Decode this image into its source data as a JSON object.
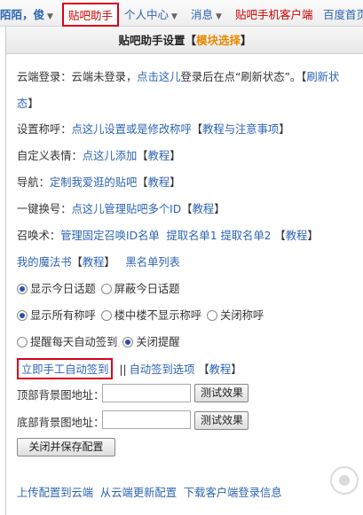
{
  "nav": {
    "user": "陌陌，俊",
    "helper": "贴吧助手",
    "personal": "个人中心",
    "messages": "消息",
    "mobile_client": "贴吧手机客户端",
    "baidu_home": "百度首页"
  },
  "panel": {
    "title": "贴吧助手设置【",
    "title_hl": "模块选择",
    "title_end": "】",
    "cloud_login": {
      "label": "云端登录：云端未登录，",
      "link": "点击这儿",
      "after": "登录后在点“刷新状态”。",
      "bracket_open": "【",
      "refresh": "刷新状态",
      "bracket_close": "】"
    },
    "nickname": {
      "label": "设置称呼：",
      "link": "点这儿设置或是修改称呼",
      "bracket_open": "【",
      "tutorial": "教程与注意事项",
      "bracket_close": "】"
    },
    "emoji": {
      "label": "自定义表情：",
      "link": "点这儿添加",
      "bracket_open": "【",
      "tutorial": "教程",
      "bracket_close": "】"
    },
    "navigation": {
      "label": "导航：",
      "link": "定制我爱逛的贴吧",
      "bracket_open": "【",
      "tutorial": "教程",
      "bracket_close": "】"
    },
    "switch_id": {
      "label": "一键换号：",
      "link": "点这儿管理贴吧多个ID",
      "bracket_open": "【",
      "tutorial": "教程",
      "bracket_close": "】"
    },
    "summon": {
      "label": "召唤术：",
      "link1": "管理固定召唤ID名单",
      "link2": "提取名单1",
      "link3": "提取名单2",
      "bracket_open": "【",
      "tutorial": "教程",
      "bracket_close": "】"
    },
    "magic": {
      "link": "我的魔法书",
      "bracket_open": "【",
      "tutorial": "教程",
      "bracket_close": "】",
      "blacklist": "黑名单列表"
    },
    "topic_opts": [
      "显示今日话题",
      "屏蔽今日话题"
    ],
    "nick_opts": [
      "显示所有称呼",
      "楼中楼不显示称呼",
      "关闭称呼"
    ],
    "remind_opts": [
      "提醒每天自动签到",
      "关闭提醒"
    ],
    "sign": {
      "manual": "立即手工自动签到",
      "sep": "||",
      "options": "自动签到选项",
      "bracket_open": "【",
      "tutorial": "教程",
      "bracket_close": "】"
    },
    "top_bg_label": "顶部背景图地址：",
    "bottom_bg_label": "底部背景图地址：",
    "top_bg_value": "",
    "bottom_bg_value": "",
    "test_btn": "测试效果",
    "close_save_btn": "关闭并保存配置",
    "footer": {
      "upload": "上传配置到云端",
      "update": "从云端更新配置",
      "download": "下载客户端登录信息"
    }
  }
}
